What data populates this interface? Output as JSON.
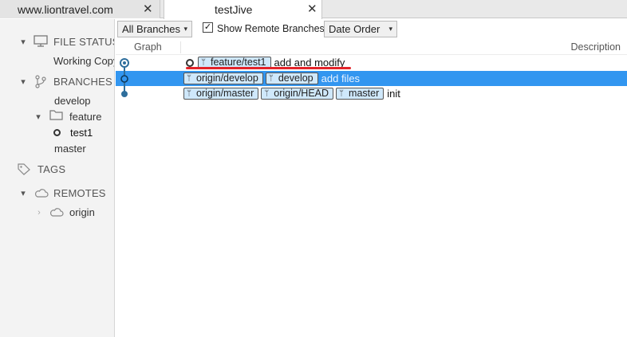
{
  "tabs": [
    {
      "title": "www.liontravel.com",
      "close": "✕"
    },
    {
      "title": "testJive",
      "close": "✕"
    }
  ],
  "sidebar": {
    "file_status": {
      "label": "FILE STATUS",
      "items": [
        {
          "label": "Working Copy"
        }
      ]
    },
    "branches": {
      "label": "BRANCHES",
      "items": [
        {
          "label": "develop"
        },
        {
          "label": "feature",
          "children": [
            {
              "label": "test1",
              "current": true
            }
          ]
        },
        {
          "label": "master"
        }
      ]
    },
    "tags": {
      "label": "TAGS"
    },
    "remotes": {
      "label": "REMOTES",
      "items": [
        {
          "label": "origin"
        }
      ]
    }
  },
  "toolbar": {
    "branch_filter": "All Branches",
    "show_remote_branches": {
      "label": "Show Remote Branches",
      "checked": true
    },
    "order": "Date Order"
  },
  "columns": {
    "graph": "Graph",
    "description": "Description"
  },
  "commits": [
    {
      "refs": [
        "feature/test1"
      ],
      "message": "add and modify",
      "head": true,
      "selected": false
    },
    {
      "refs": [
        "origin/develop",
        "develop"
      ],
      "message": "add files",
      "head": false,
      "selected": true
    },
    {
      "refs": [
        "origin/master",
        "origin/HEAD",
        "master"
      ],
      "message": "init",
      "head": false,
      "selected": false
    }
  ],
  "colors": {
    "selection": "#3296f0",
    "ref_badge": "#cfe8fb",
    "graph_node": "#2e6e9c",
    "annotation": "#e2242a"
  }
}
